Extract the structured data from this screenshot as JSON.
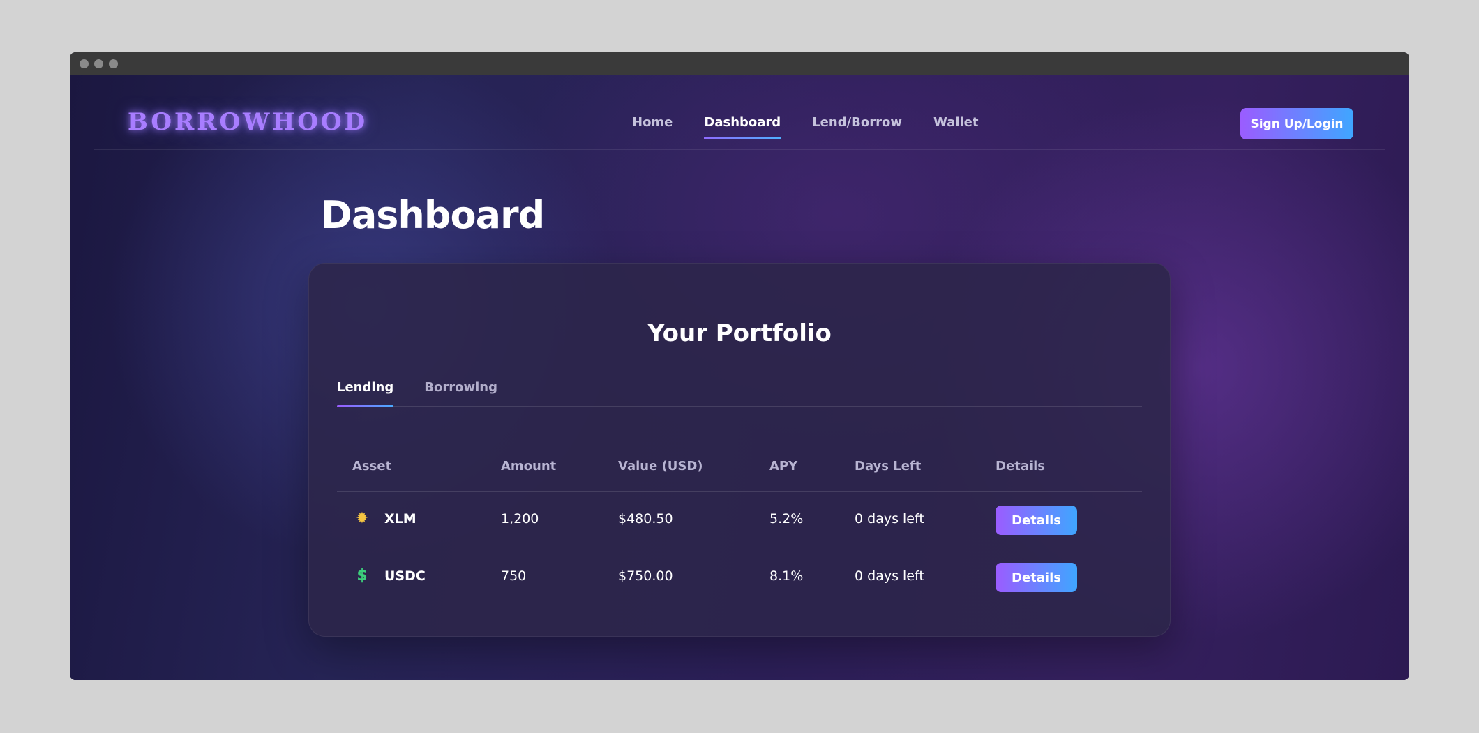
{
  "nav": {
    "logo": "BORROWHOOD",
    "items": [
      {
        "label": "Home"
      },
      {
        "label": "Dashboard"
      },
      {
        "label": "Lend/Borrow"
      },
      {
        "label": "Wallet"
      }
    ],
    "signup_label": "Sign Up/Login"
  },
  "page": {
    "title": "Dashboard"
  },
  "portfolio": {
    "title": "Your Portfolio",
    "tabs": [
      {
        "label": "Lending"
      },
      {
        "label": "Borrowing"
      }
    ],
    "active_tab": "Lending",
    "columns": [
      "Asset",
      "Amount",
      "Value (USD)",
      "APY",
      "Days Left",
      "Details"
    ],
    "rows": [
      {
        "icon": "sun-icon",
        "asset": "XLM",
        "amount": "1,200",
        "value": "$480.50",
        "apy": "5.2%",
        "days_left": "0 days left",
        "details_label": "Details"
      },
      {
        "icon": "dollar-icon",
        "asset": "USDC",
        "amount": "750",
        "value": "$750.00",
        "apy": "8.1%",
        "days_left": "0 days left",
        "details_label": "Details"
      }
    ]
  },
  "colors": {
    "accent_start": "#9b5cff",
    "accent_end": "#3fa6ff",
    "logo": "#a87dff"
  }
}
